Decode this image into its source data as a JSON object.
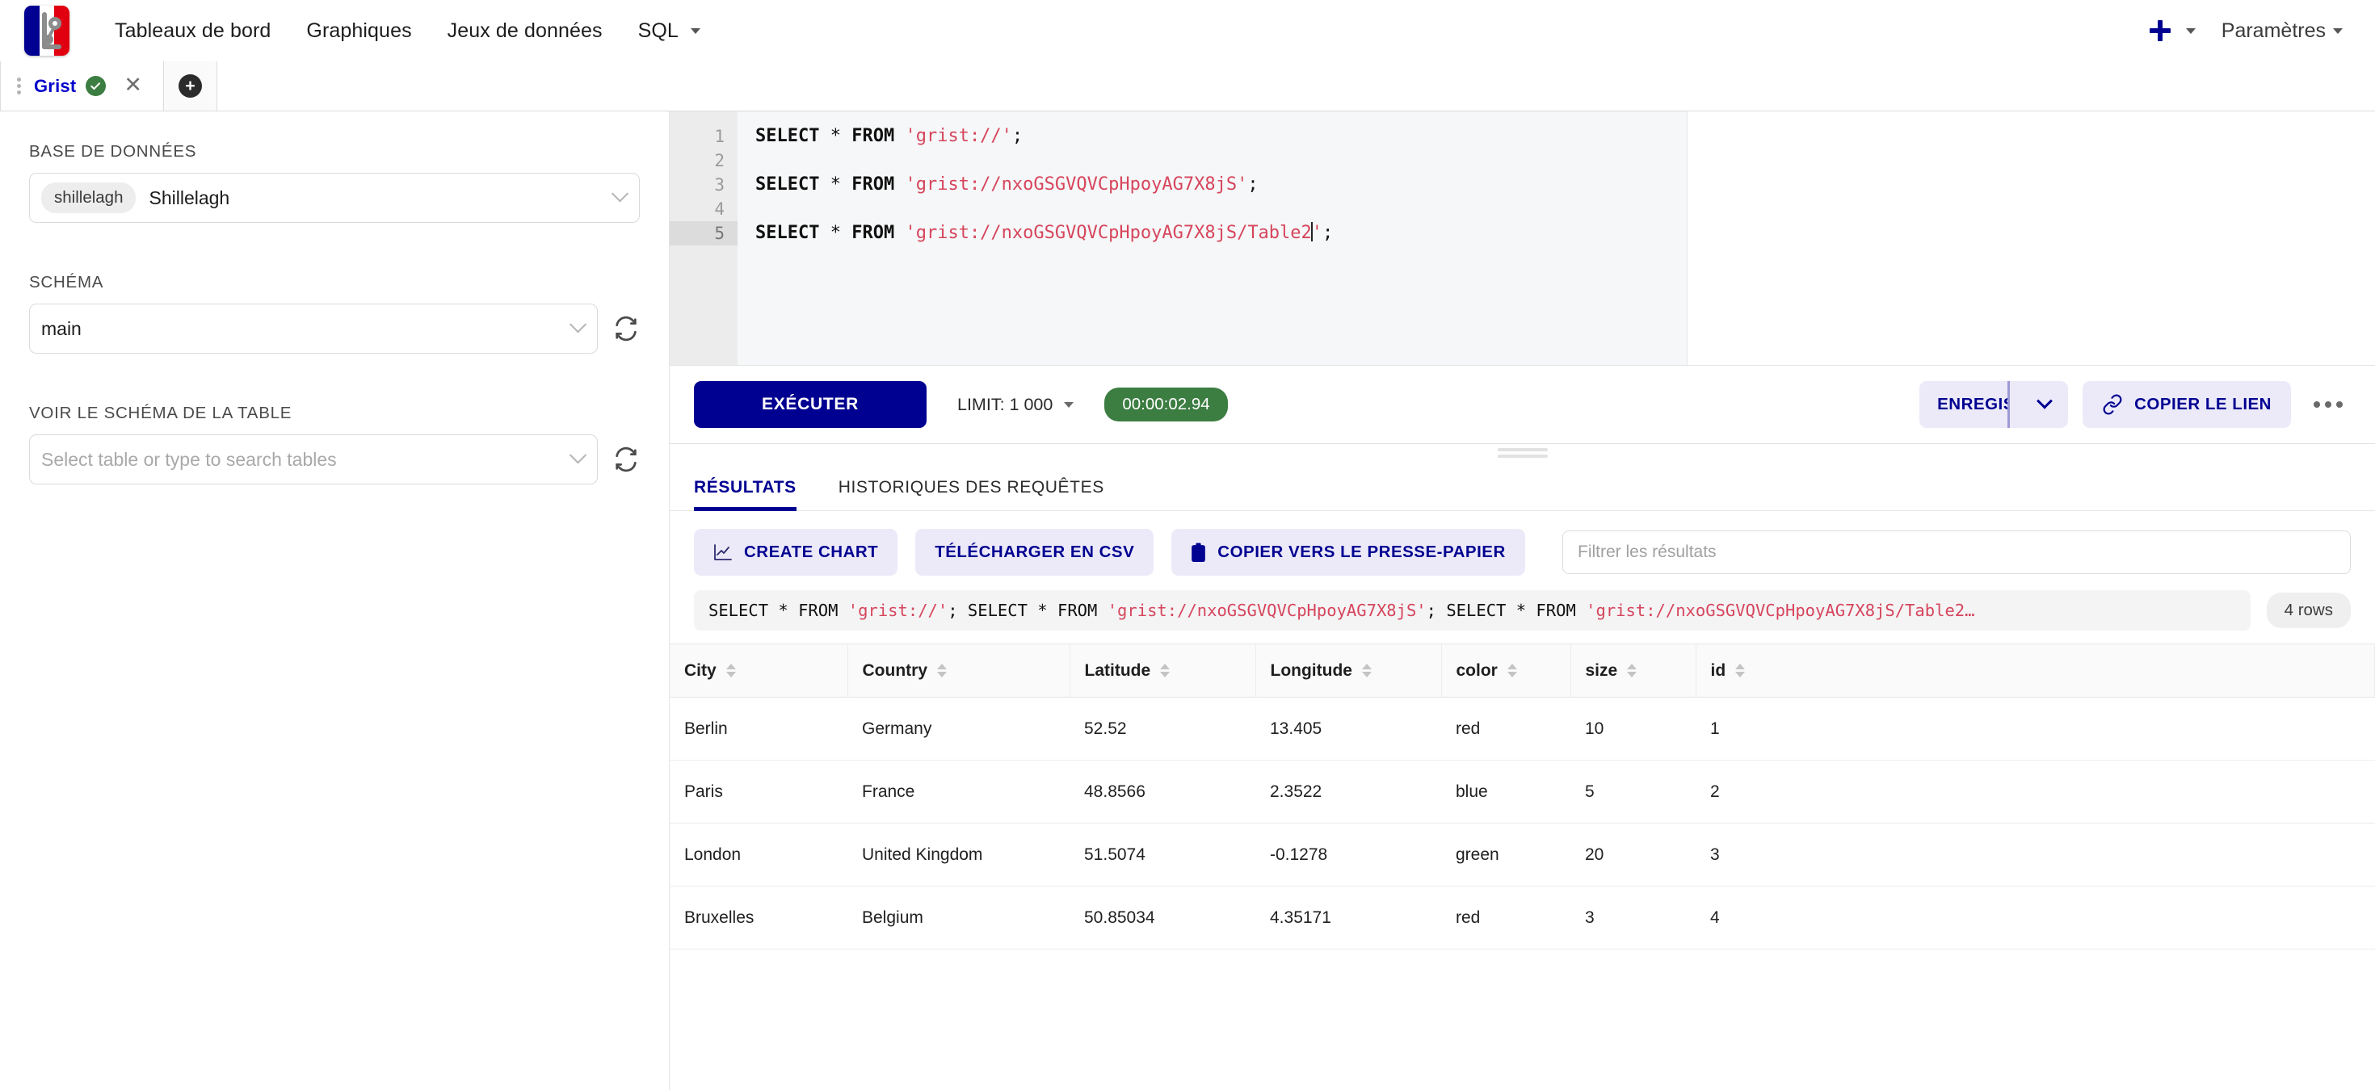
{
  "topnav": {
    "logo_name": "french-flag-logo",
    "links": [
      {
        "label": "Tableaux de bord",
        "has_caret": false
      },
      {
        "label": "Graphiques",
        "has_caret": false
      },
      {
        "label": "Jeux de données",
        "has_caret": false
      },
      {
        "label": "SQL",
        "has_caret": true
      }
    ],
    "add_label": "+",
    "settings_label": "Paramètres"
  },
  "tabbar": {
    "tab_label": "Grist",
    "tab_status": "✓",
    "close_label": "✕",
    "add_tab_label": "+"
  },
  "sidebar": {
    "database_label": "BASE DE DONNÉES",
    "database_pill": "shillelagh",
    "database_value": "Shillelagh",
    "schema_label": "SCHÉMA",
    "schema_value": "main",
    "table_label": "VOIR LE SCHÉMA DE LA TABLE",
    "table_placeholder": "Select table or type to search tables"
  },
  "editor": {
    "line_numbers": [
      "1",
      "2",
      "3",
      "4",
      "5"
    ],
    "active_line": 5,
    "lines": [
      {
        "kw1": "SELECT",
        "op": "*",
        "kw2": "FROM",
        "str": "'grist://'",
        "punc": ";",
        "caret": false
      },
      {
        "empty": true
      },
      {
        "kw1": "SELECT",
        "op": "*",
        "kw2": "FROM",
        "str": "'grist://nxoGSGVQVCpHpoyAG7X8jS'",
        "punc": ";",
        "caret": false
      },
      {
        "empty": true
      },
      {
        "kw1": "SELECT",
        "op": "*",
        "kw2": "FROM",
        "str_a": "'grist://nxoGSGVQVCpHpoyAG7X8jS/Table2",
        "str_b": "'",
        "punc": ";",
        "caret": true
      }
    ]
  },
  "runbar": {
    "run_label": "EXÉCUTER",
    "limit_label": "LIMIT:  1 000",
    "timer": "00:00:02.94",
    "save_label": "ENREGISTRER",
    "copy_link_label": "COPIER LE LIEN",
    "more_label": "•••"
  },
  "results": {
    "tabs": [
      {
        "label": "RÉSULTATS",
        "active": true
      },
      {
        "label": "HISTORIQUES DES REQUÊTES",
        "active": false
      }
    ],
    "actions": {
      "create_chart": "CREATE CHART",
      "download_csv": "TÉLÉCHARGER EN CSV",
      "copy_clipboard": "COPIER VERS LE PRESSE-PAPIER",
      "filter_placeholder": "Filtrer les résultats"
    },
    "query_summary": {
      "p1": "SELECT * FROM ",
      "s1": "'grist://'",
      "p2": "; SELECT * FROM ",
      "s2": "'grist://nxoGSGVQVCpHpoyAG7X8jS'",
      "p3": "; SELECT * FROM ",
      "s3": "'grist://nxoGSGVQVCpHpoyAG7X8jS/Table2…"
    },
    "rows_badge": "4 rows",
    "columns": [
      "City",
      "Country",
      "Latitude",
      "Longitude",
      "color",
      "size",
      "id"
    ],
    "rows": [
      {
        "City": "Berlin",
        "Country": "Germany",
        "Latitude": "52.52",
        "Longitude": "13.405",
        "color": "red",
        "size": "10",
        "id": "1"
      },
      {
        "City": "Paris",
        "Country": "France",
        "Latitude": "48.8566",
        "Longitude": "2.3522",
        "color": "blue",
        "size": "5",
        "id": "2"
      },
      {
        "City": "London",
        "Country": "United Kingdom",
        "Latitude": "51.5074",
        "Longitude": "-0.1278",
        "color": "green",
        "size": "20",
        "id": "3"
      },
      {
        "City": "Bruxelles",
        "Country": "Belgium",
        "Latitude": "50.85034",
        "Longitude": "4.35171",
        "color": "red",
        "size": "3",
        "id": "4"
      }
    ]
  },
  "colors": {
    "brand_blue": "#000091",
    "flag_red": "#e1000f",
    "accent_soft": "#eceaf9",
    "success_green": "#3c7d42",
    "string_red": "#d6455c"
  }
}
